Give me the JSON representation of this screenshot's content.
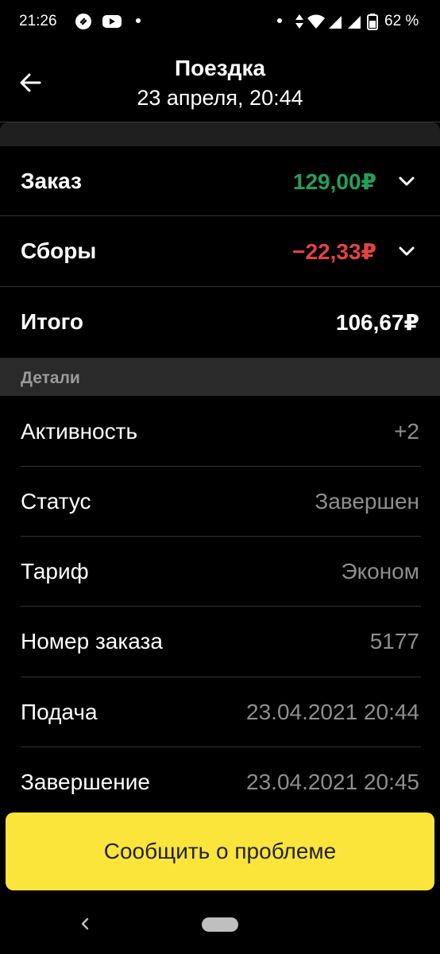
{
  "status_bar": {
    "time": "21:26",
    "battery": "62 %"
  },
  "header": {
    "title": "Поездка",
    "subtitle": "23 апреля, 20:44"
  },
  "money": {
    "order_label": "Заказ",
    "order_value": "129,00₽",
    "fees_label": "Сборы",
    "fees_value": "−22,33₽",
    "total_label": "Итого",
    "total_value": "106,67₽"
  },
  "details": {
    "section_title": "Детали",
    "rows": [
      {
        "label": "Активность",
        "value": "+2"
      },
      {
        "label": "Статус",
        "value": "Завершен"
      },
      {
        "label": "Тариф",
        "value": "Эконом"
      },
      {
        "label": "Номер заказа",
        "value": "5177"
      },
      {
        "label": "Подача",
        "value": "23.04.2021 20:44"
      },
      {
        "label": "Завершение",
        "value": "23.04.2021 20:45"
      }
    ]
  },
  "actions": {
    "report_label": "Сообщить о проблеме"
  },
  "colors": {
    "positive": "#22a05a",
    "negative": "#e54242",
    "button": "#fce53a"
  }
}
